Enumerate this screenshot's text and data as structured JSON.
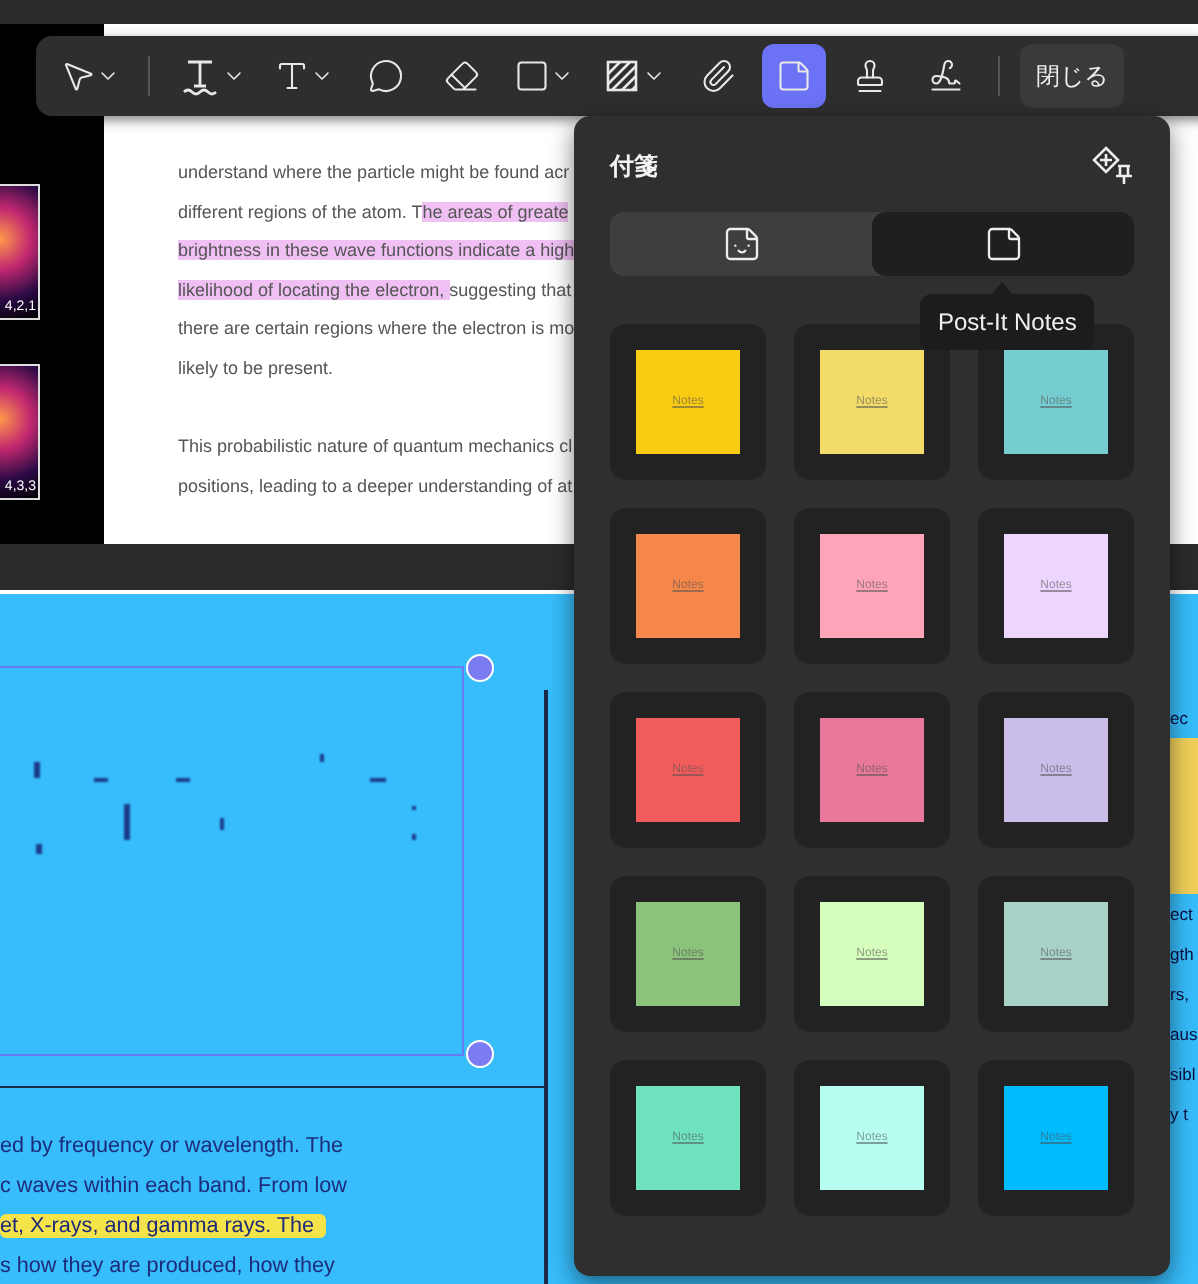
{
  "toolbar": {
    "tools": [
      {
        "kind": "select",
        "caret": true,
        "selected": false
      },
      {
        "kind": "text-underline",
        "caret": true,
        "selected": false
      },
      {
        "kind": "text",
        "caret": true,
        "selected": false
      },
      {
        "kind": "comment",
        "caret": false,
        "selected": false
      },
      {
        "kind": "eraser",
        "caret": false,
        "selected": false
      },
      {
        "kind": "rectangle",
        "caret": true,
        "selected": false
      },
      {
        "kind": "hatch",
        "caret": true,
        "selected": false
      },
      {
        "kind": "attach",
        "caret": false,
        "selected": false
      },
      {
        "kind": "note",
        "caret": false,
        "selected": true
      },
      {
        "kind": "stamp",
        "caret": false,
        "selected": false
      },
      {
        "kind": "signature",
        "caret": false,
        "selected": false
      }
    ],
    "close_button": "閉じる"
  },
  "top_page": {
    "thumbnails": [
      "4,2,1",
      "4,3,3"
    ],
    "paragraphs": [
      [
        [
          {
            "text": "understand where the particle might be found acr",
            "highlight": false
          }
        ],
        [
          {
            "text": "different regions of the atom. T",
            "highlight": false
          },
          {
            "text": "he areas of greate",
            "highlight": true
          }
        ],
        [
          {
            "text": "brightness in these wave functions indicate a high",
            "highlight": true
          }
        ],
        [
          {
            "text": "likelihood of locating the electron, ",
            "highlight": true
          },
          {
            "text": "suggesting that",
            "highlight": false
          }
        ],
        [
          {
            "text": "there are certain regions where the electron is mo",
            "highlight": false
          }
        ],
        [
          {
            "text": "likely to be present.",
            "highlight": false
          }
        ]
      ],
      [
        [
          {
            "text": "This probabilistic nature of quantum mechanics cl",
            "highlight": false
          }
        ],
        [
          {
            "text": "positions, leading to a deeper understanding of at",
            "highlight": false
          }
        ]
      ]
    ]
  },
  "bottom_page": {
    "lines": [
      {
        "text": "ed by frequency or wavelength. The",
        "highlight": false
      },
      {
        "text": "c waves within each band. From low",
        "highlight": false
      },
      {
        "text": "et, X-rays, and gamma rays. The",
        "highlight": true
      },
      {
        "text": "s how they are produced, how they",
        "highlight": false
      }
    ],
    "right_fragments": [
      {
        "text": "ec",
        "highlight": false
      },
      {
        "highlight": true
      },
      {
        "text": "ect",
        "highlight": false
      },
      {
        "text": "gth",
        "highlight": false
      },
      {
        "text": "rs,",
        "highlight": false
      },
      {
        "text": "aus",
        "highlight": false
      },
      {
        "text": "sibl",
        "highlight": false
      },
      {
        "text": "y t",
        "highlight": false
      }
    ]
  },
  "notes_panel": {
    "title": "付箋",
    "tabs": [
      {
        "kind": "stickers",
        "selected": false
      },
      {
        "kind": "notes",
        "selected": true
      }
    ],
    "tooltip": "Post-It Notes",
    "notes": [
      {
        "label": "Notes",
        "color": "#f9cb13"
      },
      {
        "label": "Notes",
        "color": "#f3dc6a"
      },
      {
        "label": "Notes",
        "color": "#76cdd0"
      },
      {
        "label": "Notes",
        "color": "#f6874b"
      },
      {
        "label": "Notes",
        "color": "#fda4b8"
      },
      {
        "label": "Notes",
        "color": "#edd6fe"
      },
      {
        "label": "Notes",
        "color": "#f35c5c"
      },
      {
        "label": "Notes",
        "color": "#e8799a"
      },
      {
        "label": "Notes",
        "color": "#cabdea"
      },
      {
        "label": "Notes",
        "color": "#8cc37c"
      },
      {
        "label": "Notes",
        "color": "#d5fdbd"
      },
      {
        "label": "Notes",
        "color": "#a8d1c8"
      },
      {
        "label": "Notes",
        "color": "#6fe2c0"
      },
      {
        "label": "Notes",
        "color": "#b7fef0"
      },
      {
        "label": "Notes",
        "color": "#00bbfd"
      }
    ]
  }
}
